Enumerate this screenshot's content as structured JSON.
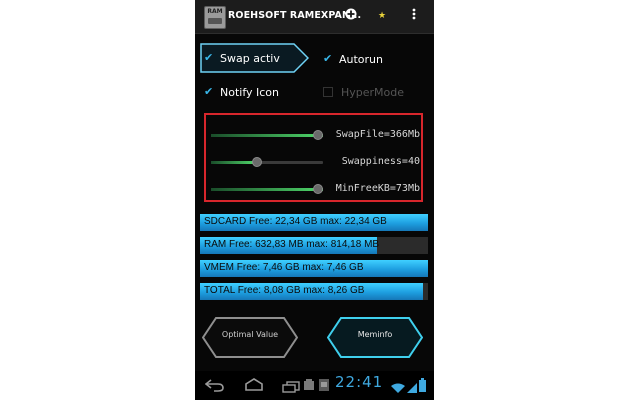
{
  "app": {
    "title": "ROEHSOFT RAMEXPAN...",
    "icon_text": "RAM",
    "icons": [
      "add-circle-icon",
      "star-icon",
      "overflow-menu-icon"
    ]
  },
  "options": {
    "swap_active": {
      "label": "Swap activ",
      "checked": true
    },
    "autorun": {
      "label": "Autorun",
      "checked": true
    },
    "notify_icon": {
      "label": "Notify Icon",
      "checked": true
    },
    "hypermode": {
      "label": "HyperMode",
      "checked": false
    }
  },
  "sliders": [
    {
      "label": "SwapFile=366Mb",
      "value": 1.0
    },
    {
      "label": "Swappiness=40",
      "value": 0.4
    },
    {
      "label": "MinFreeKB=73Mb",
      "value": 1.0
    }
  ],
  "memory": [
    {
      "label": "SDCARD Free: 22,34 GB  max: 22,34 GB",
      "free_fraction": 1.0
    },
    {
      "label": "RAM Free: 632,83 MB  max: 814,18 MB",
      "free_fraction": 0.777
    },
    {
      "label": "VMEM Free: 7,46 GB  max: 7,46 GB",
      "free_fraction": 1.0
    },
    {
      "label": "TOTAL Free: 8,08 GB  max: 8,26 GB",
      "free_fraction": 0.978
    }
  ],
  "buttons": {
    "optimal": "Optimal Value",
    "meminfo": "Meminfo"
  },
  "status": {
    "time": "22:41"
  },
  "colors": {
    "accent": "#39b6e8",
    "slider_fill": "#4fd86a",
    "highlight_box": "#d8262c",
    "bar_fill": "#1e9fe0"
  }
}
